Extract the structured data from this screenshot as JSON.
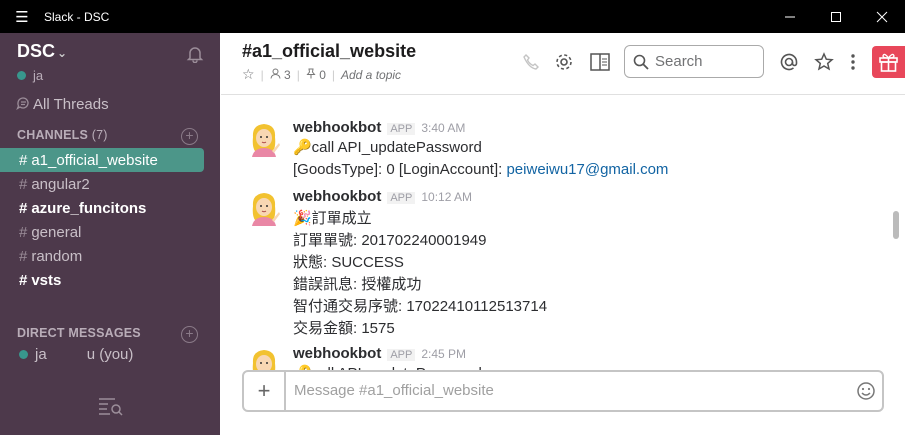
{
  "window": {
    "title": "Slack - DSC",
    "menu_icon": "hamburger-icon",
    "minimize_icon": "minimize-icon",
    "maximize_icon": "maximize-icon",
    "close_icon": "close-icon"
  },
  "sidebar": {
    "team": "DSC",
    "user": "ja",
    "all_threads": "All Threads",
    "channels_header": "CHANNELS",
    "channels_count": "(7)",
    "channels": [
      {
        "name": "a1_official_website",
        "state": "active"
      },
      {
        "name": "angular2",
        "state": "normal"
      },
      {
        "name": "azure_funcitons",
        "state": "unread"
      },
      {
        "name": "general",
        "state": "normal"
      },
      {
        "name": "random",
        "state": "normal"
      },
      {
        "name": "vsts",
        "state": "unread"
      }
    ],
    "dm_header": "DIRECT MESSAGES",
    "dm_user": "ja",
    "dm_you": "u (you)",
    "accent_color": "#4c9689",
    "bg_color": "#4d394b"
  },
  "header": {
    "channel": "#a1_official_website",
    "members": "3",
    "pins": "0",
    "topic_placeholder": "Add a topic",
    "search_placeholder": "Search"
  },
  "messages": [
    {
      "sender": "webhookbot",
      "badge": "APP",
      "time": "3:40 AM",
      "lines": [
        "🔑call API_updatePassword",
        "[GoodsType]: 0  [LoginAccount]: "
      ],
      "link": "peiweiwu17@gmail.com"
    },
    {
      "sender": "webhookbot",
      "badge": "APP",
      "time": "10:12 AM",
      "lines": [
        "🎉訂單成立",
        "訂單單號: 201702240001949",
        "狀態: SUCCESS",
        "錯誤訊息: 授權成功",
        "智付通交易序號: 17022410112513714",
        "交易金額: 1575"
      ]
    },
    {
      "sender": "webhookbot",
      "badge": "APP",
      "time": "2:45 PM",
      "lines": [
        "🔑call API_updatePassword"
      ]
    }
  ],
  "composer": {
    "placeholder": "Message #a1_official_website"
  }
}
